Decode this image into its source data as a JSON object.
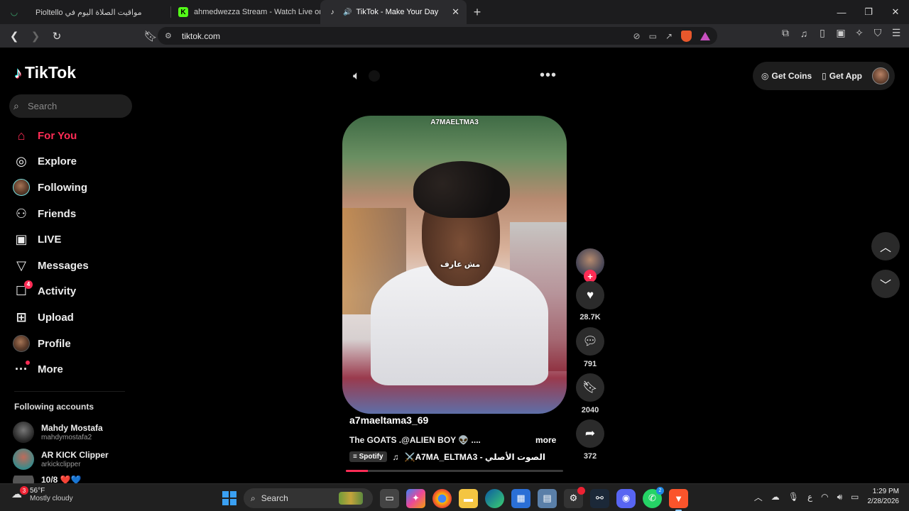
{
  "browser": {
    "tabs": [
      {
        "title": "مواقيت الصلاة اليوم في Pioltello",
        "active": false
      },
      {
        "title": "ahmedwezza Stream - Watch Live on",
        "active": false
      },
      {
        "title": "TikTok - Make Your Day",
        "active": true
      }
    ],
    "url": "tiktok.com",
    "brave_badge": "9"
  },
  "tiktok": {
    "logo": "TikTok",
    "search_placeholder": "Search",
    "nav": [
      {
        "label": "For You",
        "icon": "home-icon",
        "active": true
      },
      {
        "label": "Explore",
        "icon": "compass-icon",
        "active": false
      },
      {
        "label": "Following",
        "icon": "following-avatar-icon",
        "active": false
      },
      {
        "label": "Friends",
        "icon": "friends-icon",
        "active": false
      },
      {
        "label": "LIVE",
        "icon": "live-tv-icon",
        "active": false
      },
      {
        "label": "Messages",
        "icon": "messages-icon",
        "active": false
      },
      {
        "label": "Activity",
        "icon": "activity-icon",
        "active": false,
        "badge": "4"
      },
      {
        "label": "Upload",
        "icon": "upload-icon",
        "active": false
      },
      {
        "label": "Profile",
        "icon": "profile-avatar-icon",
        "active": false
      },
      {
        "label": "More",
        "icon": "more-dots-icon",
        "active": false
      }
    ],
    "following_title": "Following accounts",
    "following_accounts": [
      {
        "name": "Mahdy Mostafa",
        "handle": "mahdymostafa2"
      },
      {
        "name": "AR KICK Clipper",
        "handle": "arkickclipper"
      },
      {
        "name": "10/8 ❤️💙",
        "handle": ""
      }
    ],
    "video": {
      "watermark": "A7MAELTMA3",
      "overlay_caption": "مش عارف",
      "author": "a7maeltama3_69",
      "description": "The GOATS .@ALIEN BOY 👽 ....",
      "more_label": "more",
      "music_tag": "Spotify",
      "music": "الصوت الأصلي - A7MA_ELTMA3⚔️",
      "progress": 0.1
    },
    "actions": {
      "likes": "28.7K",
      "comments": "791",
      "saves": "2040",
      "shares": "372"
    },
    "top_right": {
      "coins_label": "Get Coins",
      "app_label": "Get App"
    }
  },
  "taskbar": {
    "weather_temp": "56°F",
    "weather_cond": "Mostly cloudy",
    "weather_badge": "3",
    "search_label": "Search",
    "whatsapp_badge": "2",
    "lang": "ع",
    "time": "1:29 PM",
    "date": "2/28/2026"
  }
}
